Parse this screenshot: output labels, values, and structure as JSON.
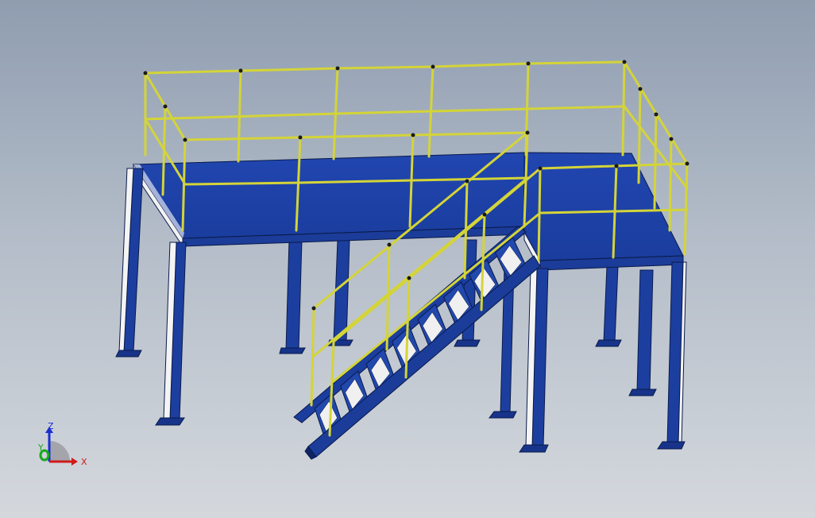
{
  "viewport": {
    "background_top": "#8f9db0",
    "background_bottom": "#d4d8dd"
  },
  "model": {
    "steel_color": "#1e43a8",
    "steel_dark": "#102a78",
    "rail_color": "#d9d93a",
    "rail_dark": "#6b6b10",
    "stair_steps": 8
  },
  "triad": {
    "x_label": "X",
    "y_label": "Y",
    "z_label": "Z",
    "x_color": "#d11a1a",
    "y_color": "#1aa81a",
    "z_color": "#1a2fd1"
  }
}
